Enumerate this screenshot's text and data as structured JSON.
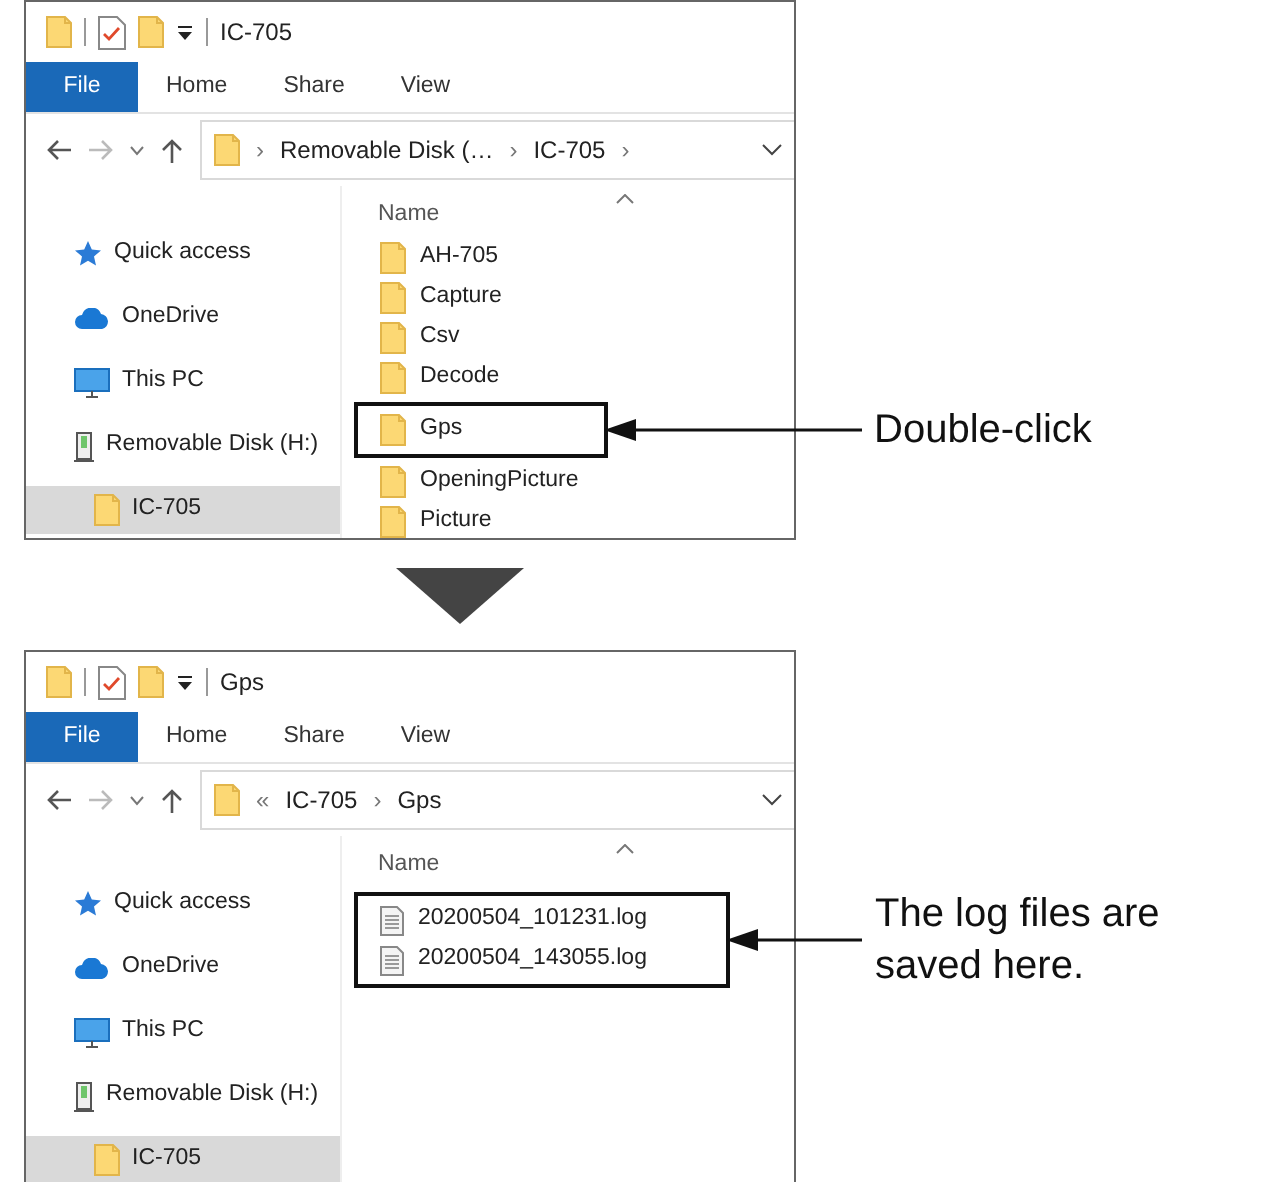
{
  "figures": [
    {
      "window": {
        "title": "IC-705"
      },
      "tabs": [
        {
          "label": "File",
          "selected": true
        },
        {
          "label": "Home",
          "selected": false
        },
        {
          "label": "Share",
          "selected": false
        },
        {
          "label": "View",
          "selected": false
        }
      ],
      "address": [
        {
          "kind": "separator",
          "text": "›"
        },
        {
          "kind": "name",
          "text": "Removable Disk (…"
        },
        {
          "kind": "separator",
          "text": "›"
        },
        {
          "kind": "name",
          "text": "IC-705"
        },
        {
          "kind": "separator",
          "text": "›"
        }
      ],
      "nav": [
        {
          "label": "Quick access",
          "kind": "quick-access",
          "selected": false
        },
        {
          "label": "OneDrive",
          "kind": "cloud",
          "selected": false
        },
        {
          "label": "This PC",
          "kind": "pc",
          "selected": false
        },
        {
          "label": "Removable Disk (H:)",
          "kind": "drive",
          "selected": false,
          "children": [
            {
              "label": "IC-705",
              "kind": "folder",
              "selected": true
            }
          ]
        }
      ],
      "column_header": "Name",
      "files": [
        {
          "name": "AH-705",
          "kind": "folder",
          "highlighted": false
        },
        {
          "name": "Capture",
          "kind": "folder",
          "highlighted": false
        },
        {
          "name": "Csv",
          "kind": "folder",
          "highlighted": false
        },
        {
          "name": "Decode",
          "kind": "folder",
          "highlighted": false
        },
        {
          "name": "Gps",
          "kind": "folder",
          "highlighted": true
        },
        {
          "name": "OpeningPicture",
          "kind": "folder",
          "highlighted": false
        },
        {
          "name": "Picture",
          "kind": "folder",
          "highlighted": false
        }
      ],
      "callout": "Double-click"
    },
    {
      "window": {
        "title": "Gps"
      },
      "tabs": [
        {
          "label": "File",
          "selected": true
        },
        {
          "label": "Home",
          "selected": false
        },
        {
          "label": "Share",
          "selected": false
        },
        {
          "label": "View",
          "selected": false
        }
      ],
      "address": [
        {
          "kind": "separator",
          "text": "«"
        },
        {
          "kind": "name",
          "text": "IC-705"
        },
        {
          "kind": "separator",
          "text": "›"
        },
        {
          "kind": "name",
          "text": "Gps"
        }
      ],
      "nav": [
        {
          "label": "Quick access",
          "kind": "quick-access",
          "selected": false
        },
        {
          "label": "OneDrive",
          "kind": "cloud",
          "selected": false
        },
        {
          "label": "This PC",
          "kind": "pc",
          "selected": false
        },
        {
          "label": "Removable Disk (H:)",
          "kind": "drive",
          "selected": false,
          "children": [
            {
              "label": "IC-705",
              "kind": "folder",
              "selected": true
            }
          ]
        }
      ],
      "column_header": "Name",
      "files": [
        {
          "name": "20200504_101231.log",
          "kind": "log",
          "highlighted": true
        },
        {
          "name": "20200504_143055.log",
          "kind": "log",
          "highlighted": true
        }
      ],
      "callout": "The log files are saved here."
    }
  ]
}
